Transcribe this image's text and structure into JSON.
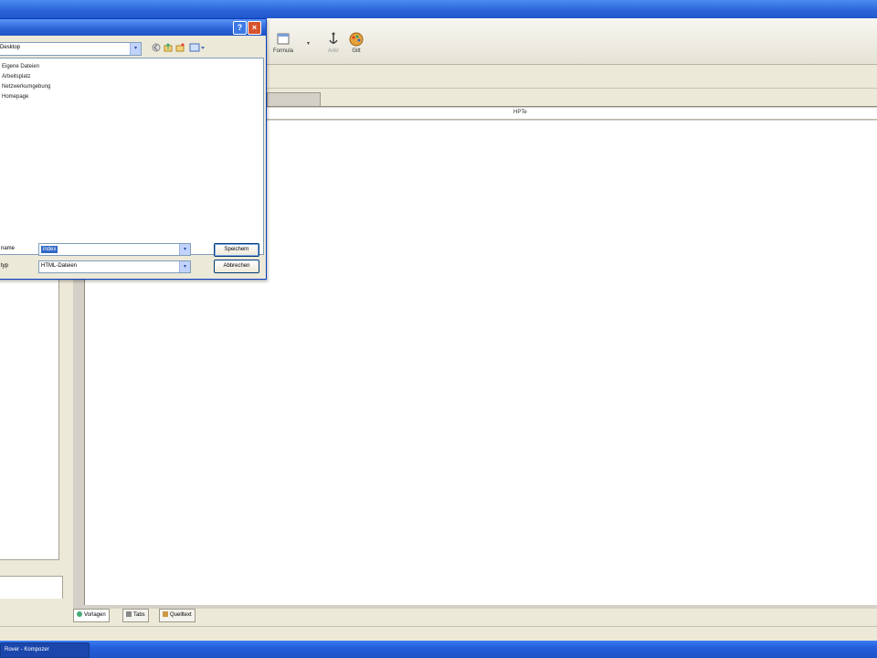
{
  "app": {
    "title": ""
  },
  "toolbar": {
    "formula_label": "Formula",
    "button2_label": "Ankr",
    "button3_label": "Gitt"
  },
  "ruler": {
    "label": "HPTe"
  },
  "view_tabs": [
    "Vorlagen",
    "Tabs",
    "Quelltext"
  ],
  "taskbar": {
    "task_label": "Rover - Kompozer"
  },
  "dialog": {
    "look_in": "Desktop",
    "files": [
      "Eigene Dateien",
      "Arbeitsplatz",
      "Netzwerkumgebung",
      "Homepage"
    ],
    "filename_label": "name",
    "filename_value": "index",
    "filetype_label": "typ",
    "filetype_value": "HTML-Dateien",
    "save_button": "Speichern",
    "cancel_button": "Abbrechen"
  }
}
